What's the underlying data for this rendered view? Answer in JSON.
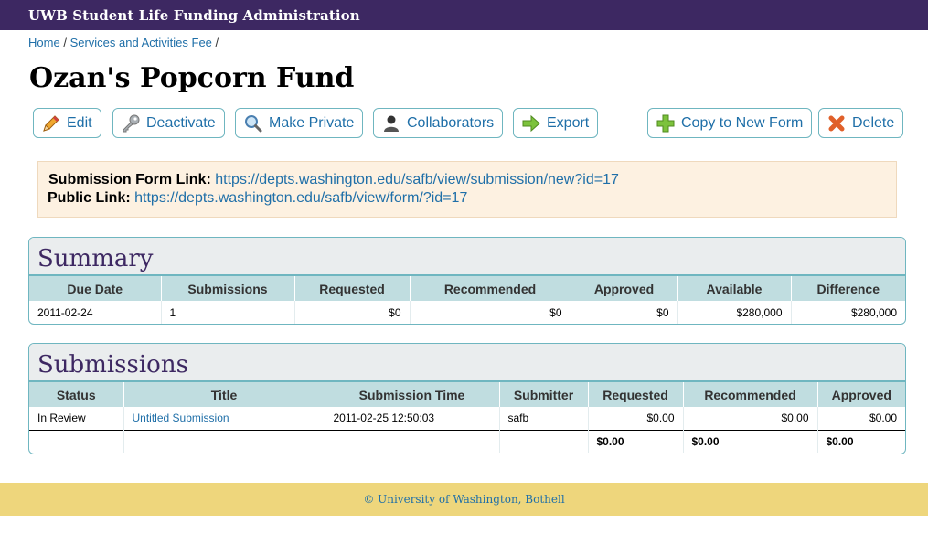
{
  "app": {
    "title": "UWB Student Life Funding Administration"
  },
  "breadcrumb": [
    {
      "label": "Home"
    },
    {
      "label": "Services and Activities Fee"
    }
  ],
  "breadcrumb_separator": "/",
  "page": {
    "title": "Ozan's Popcorn Fund"
  },
  "toolbar": {
    "edit": "Edit",
    "deactivate": "Deactivate",
    "make_private": "Make Private",
    "collaborators": "Collaborators",
    "export": "Export",
    "copy_to_new_form": "Copy to New Form",
    "delete": "Delete"
  },
  "icons": {
    "edit": "pencil-icon",
    "deactivate": "key-icon",
    "make_private": "magnifier-icon",
    "collaborators": "person-icon",
    "export": "arrow-right-icon",
    "copy": "plus-icon",
    "delete": "x-icon"
  },
  "links": {
    "submission_label": "Submission Form Link:",
    "submission_url": "https://depts.washington.edu/safb/view/submission/new?id=17",
    "public_label": "Public Link:",
    "public_url": "https://depts.washington.edu/safb/view/form/?id=17"
  },
  "summary": {
    "title": "Summary",
    "headers": [
      "Due Date",
      "Submissions",
      "Requested",
      "Recommended",
      "Approved",
      "Available",
      "Difference"
    ],
    "row": [
      "2011-02-24",
      "1",
      "$0",
      "$0",
      "$0",
      "$280,000",
      "$280,000"
    ]
  },
  "submissions": {
    "title": "Submissions",
    "headers": [
      "Status",
      "Title",
      "Submission Time",
      "Submitter",
      "Requested",
      "Recommended",
      "Approved"
    ],
    "rows": [
      [
        "In Review",
        "Untitled Submission",
        "2011-02-25 12:50:03",
        "safb",
        "$0.00",
        "$0.00",
        "$0.00"
      ]
    ],
    "totals": [
      "$0.00",
      "$0.00",
      "$0.00"
    ]
  },
  "footer": {
    "text": "© University of Washington, Bothell"
  },
  "colors": {
    "topbar": "#3d2862",
    "link": "#1f6fa8",
    "panel_border": "#6fb6c0",
    "table_header": "#c0dde0",
    "notice_bg": "#fdf1e1",
    "footer_bg": "#eed67c"
  }
}
